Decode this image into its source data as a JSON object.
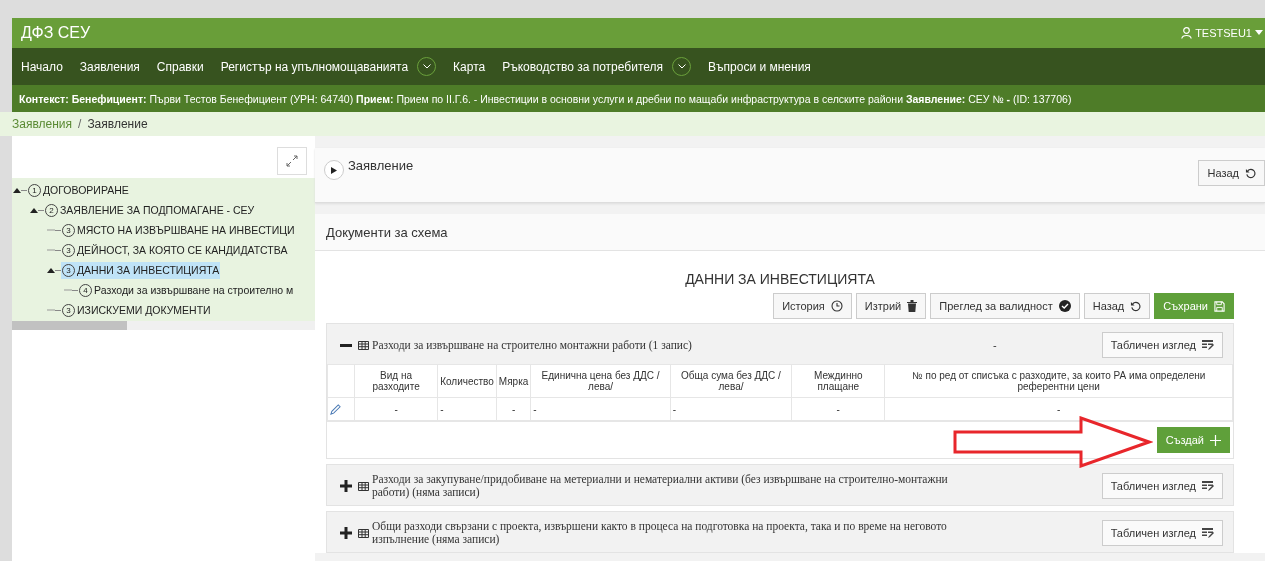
{
  "app_bar": {
    "title": "ДФЗ СЕУ",
    "user": "TESTSEU1"
  },
  "nav": [
    {
      "label": "Начало",
      "dropdown": false
    },
    {
      "label": "Заявления",
      "dropdown": false
    },
    {
      "label": "Справки",
      "dropdown": false
    },
    {
      "label": "Регистър на упълномощаванията",
      "dropdown": true
    },
    {
      "label": "Карта",
      "dropdown": false
    },
    {
      "label": "Ръководство за потребителя",
      "dropdown": true
    },
    {
      "label": "Въпроси и мнения",
      "dropdown": false
    }
  ],
  "context_bar": "**Контекст: Бенефициент:** Първи Тестов Бенефициент (УРН: 64740) **Прием:** Прием по II.Г.6. - Инвестиции в основни услуги и дребни по мащаби инфраструктура в селските райони **Заявление:** СЕУ № **-** (ID: 137706)",
  "breadcrumb_separator": "/",
  "breadcrumb": [
    {
      "label": "Заявления",
      "link": true
    },
    {
      "label": "Заявление",
      "link": false
    }
  ],
  "tree": [
    {
      "number": "1",
      "label": "ДОГОВОРИРАНЕ",
      "expanded": true,
      "selected": false,
      "children": [
        {
          "number": "2",
          "label": "ЗАЯВЛЕНИЕ ЗА ПОДПОМАГАНЕ - СЕУ",
          "expanded": true,
          "selected": false,
          "children": [
            {
              "number": "3",
              "label": "МЯСТО НА ИЗВЪРШВАНЕ НА ИНВЕСТИЦИ",
              "expanded": false,
              "selected": false
            },
            {
              "number": "3",
              "label": "ДЕЙНОСТ, ЗА КОЯТО СЕ КАНДИДАТСТВА",
              "expanded": false,
              "selected": false
            },
            {
              "number": "3",
              "label": "ДАННИ ЗА ИНВЕСТИЦИЯТА",
              "expanded": true,
              "selected": true,
              "children": [
                {
                  "number": "4",
                  "label": "Разходи за извършване на строително м",
                  "expanded": false,
                  "selected": false
                }
              ]
            },
            {
              "number": "3",
              "label": "ИЗИСКУЕМИ ДОКУМЕНТИ",
              "expanded": false,
              "selected": false
            }
          ]
        }
      ]
    }
  ],
  "application_card": {
    "title": "Заявление",
    "back": "Назад"
  },
  "documents_card": {
    "title": "Документи за схема"
  },
  "form": {
    "title": "ДАННИ ЗА ИНВЕСТИЦИЯТА",
    "actions": [
      {
        "label": "История",
        "kind": "history"
      },
      {
        "label": "Изтрий",
        "kind": "delete"
      },
      {
        "label": "Преглед за валидност",
        "kind": "validate"
      },
      {
        "label": "Назад",
        "kind": "back"
      },
      {
        "label": "Съхрани",
        "kind": "save"
      }
    ],
    "sections": [
      {
        "title": "Разходи за извършване на строително монтажни работи (1 запис)",
        "expanded": true,
        "status": "-",
        "view_button": "Табличен изглед",
        "columns": [
          "Вид на разходите",
          "Количество",
          "Мярка",
          "Единична цена без ДДС / лева/",
          "Обща сума без ДДС / лева/",
          "Междинно плащане",
          "№ по ред от списъка с разходите, за които РА има определени референтни цени"
        ],
        "rows": [
          [
            "-",
            "-",
            "-",
            "-",
            "-",
            "-",
            "-"
          ]
        ],
        "create_button": "Създай"
      },
      {
        "title": "Разходи за закупуване/придобиване на метериални и нематериални активи (без извършване на строително-монтажни работи) (няма записи)",
        "expanded": false,
        "view_button": "Табличен изглед"
      },
      {
        "title": "Общи разходи свързани с проекта, извършени както в процеса на подготовка на проекта, така и по време на неговото изпълнение (няма записи)",
        "expanded": false,
        "view_button": "Табличен изглед"
      }
    ]
  }
}
